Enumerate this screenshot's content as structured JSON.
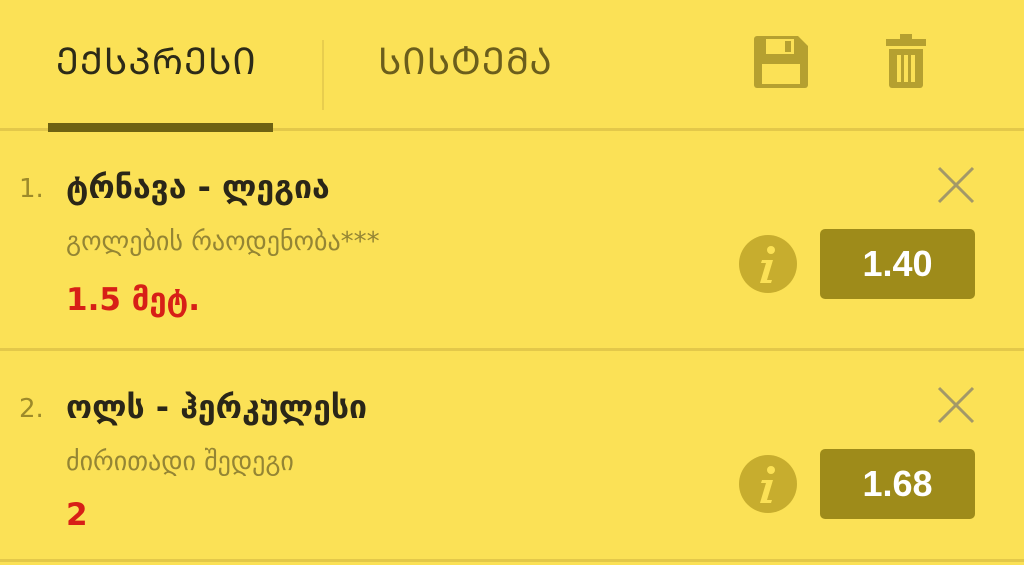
{
  "tabs": [
    {
      "label": "ᲔᲥᲡᲞᲠᲔᲡᲘ",
      "active": true
    },
    {
      "label": "ᲡᲘᲡᲢᲔᲛᲐ",
      "active": false
    }
  ],
  "toolbar": {
    "save_icon": "floppy-disk-icon",
    "delete_icon": "trash-can-icon"
  },
  "bets": [
    {
      "index": "1.",
      "match": "ტრნავა - ლეგია",
      "market": "გოლების რაოდენობა***",
      "selection": "1.5 მეტ.",
      "odds": "1.40"
    },
    {
      "index": "2.",
      "match": "ოლს - ჰერკულესი",
      "market": "ძირითადი შედეგი",
      "selection": "2",
      "odds": "1.68"
    }
  ],
  "colors": {
    "background": "#fbe156",
    "accent_dark": "#6e6212",
    "odds_button": "#9e8b1a",
    "selection_red": "#d71f17"
  }
}
